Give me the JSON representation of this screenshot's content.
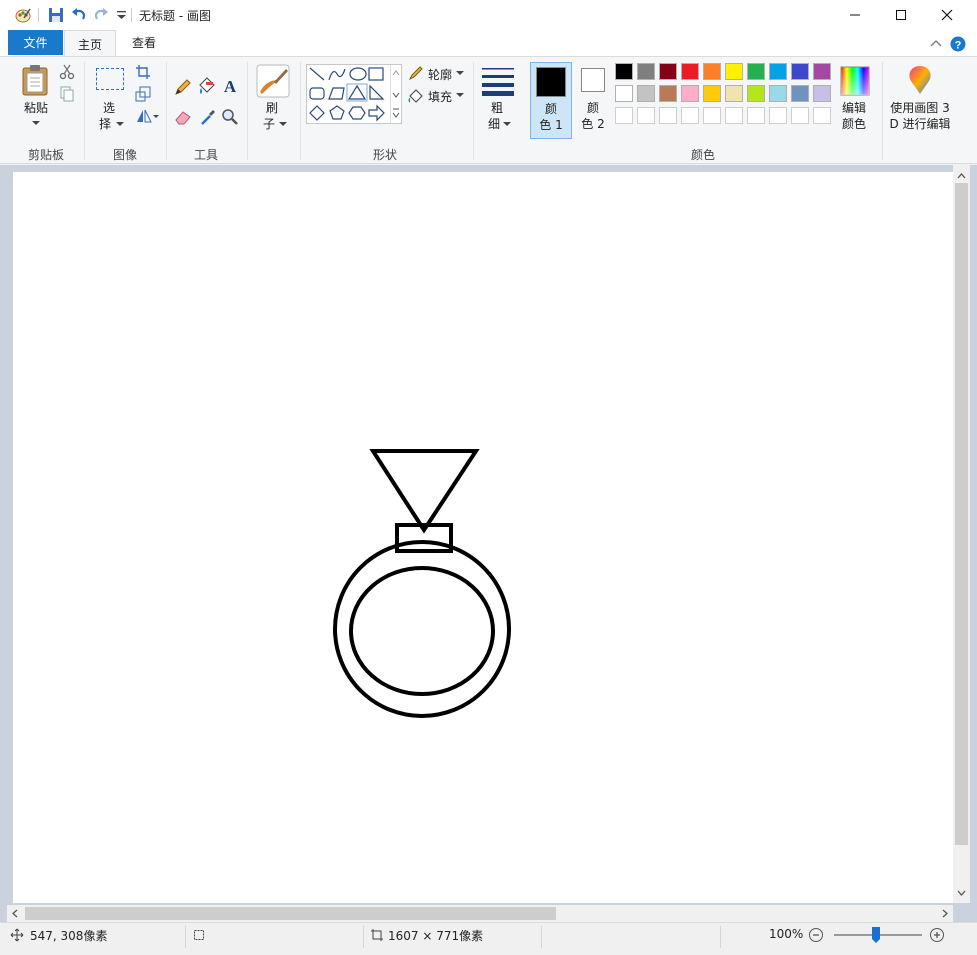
{
  "titlebar": {
    "title": "无标题 - 画图"
  },
  "tabs": {
    "file": "文件",
    "home": "主页",
    "view": "查看"
  },
  "clipboard": {
    "paste": "粘贴",
    "group": "剪贴板"
  },
  "image": {
    "select": "选",
    "select2": "择",
    "group": "图像"
  },
  "tools": {
    "group": "工具"
  },
  "brushes": {
    "label": "刷",
    "label2": "子"
  },
  "shapes": {
    "outline": "轮廓",
    "fill": "填充",
    "group": "形状"
  },
  "size": {
    "label": "粗",
    "label2": "细"
  },
  "color1": {
    "label": "颜",
    "label2": "色 1",
    "value": "#000000"
  },
  "color2": {
    "label": "颜",
    "label2": "色 2",
    "value": "#ffffff"
  },
  "colors": {
    "group": "颜色",
    "row1": [
      "#000000",
      "#7f7f7f",
      "#880015",
      "#ed1c24",
      "#ff7f27",
      "#fff200",
      "#22b14c",
      "#00a2e8",
      "#3f48cc",
      "#a349a4"
    ],
    "row2": [
      "#ffffff",
      "#c3c3c3",
      "#b97a57",
      "#ffaec9",
      "#ffc90e",
      "#efe4b0",
      "#b5e61d",
      "#99d9ea",
      "#7092be",
      "#c8bfe7"
    ],
    "row3": [
      "#ffffff",
      "#ffffff",
      "#ffffff",
      "#ffffff",
      "#ffffff",
      "#ffffff",
      "#ffffff",
      "#ffffff",
      "#ffffff",
      "#ffffff"
    ]
  },
  "edit_colors": {
    "label": "编辑",
    "label2": "颜色"
  },
  "paint3d": {
    "label": "使用画图 3",
    "label2": "D 进行编辑"
  },
  "status": {
    "cursor": "547, 308像素",
    "size": "1607 × 771像素",
    "zoom": "100%"
  }
}
